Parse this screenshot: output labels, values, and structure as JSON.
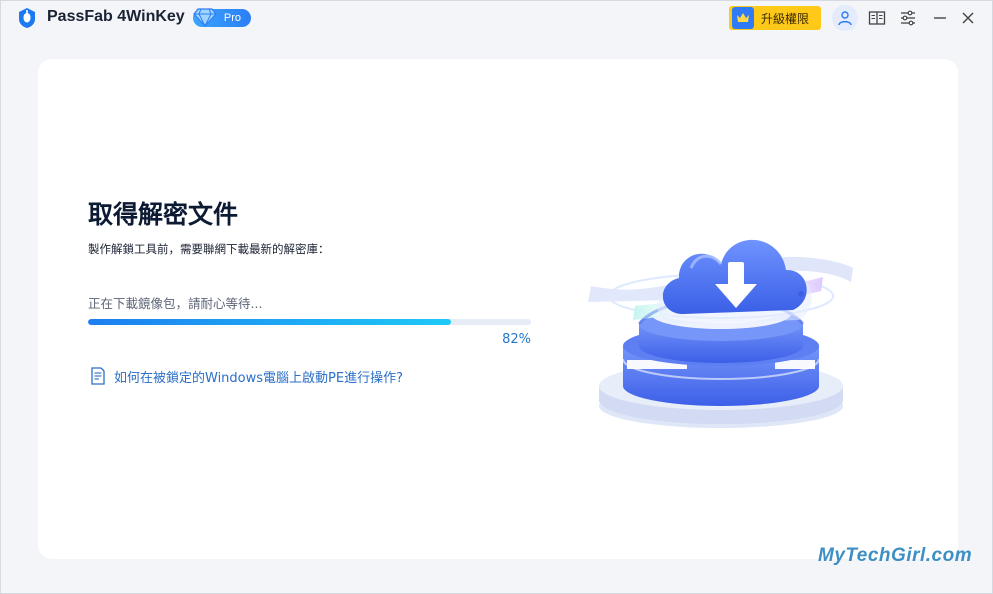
{
  "app": {
    "title": "PassFab 4WinKey",
    "edition_badge": "Pro"
  },
  "toolbar": {
    "upgrade_label": "升級權限"
  },
  "main": {
    "heading": "取得解密文件",
    "description": "製作解鎖工具前，需要聯網下載最新的解密庫：",
    "status_text": "正在下載鏡像包，請耐心等待...",
    "progress_percent_label": "82%",
    "progress_value": 82,
    "help_link_text": "如何在被鎖定的Windows電腦上啟動PE進行操作?"
  },
  "watermark": {
    "text": "MyTechGirl.com"
  },
  "colors": {
    "accent": "#1c7ff0",
    "progress_end": "#1fc9f6",
    "upgrade_bg": "#ffc91a",
    "link": "#2a6fc8"
  },
  "icons": {
    "logo": "passfab-logo-icon",
    "gem": "diamond-icon",
    "upgrade": "crown-icon",
    "user": "user-icon",
    "guide": "book-icon",
    "settings": "sliders-icon",
    "minimize": "minimize-icon",
    "close": "close-icon",
    "help": "document-icon",
    "illustration": "cloud-download-icon"
  }
}
